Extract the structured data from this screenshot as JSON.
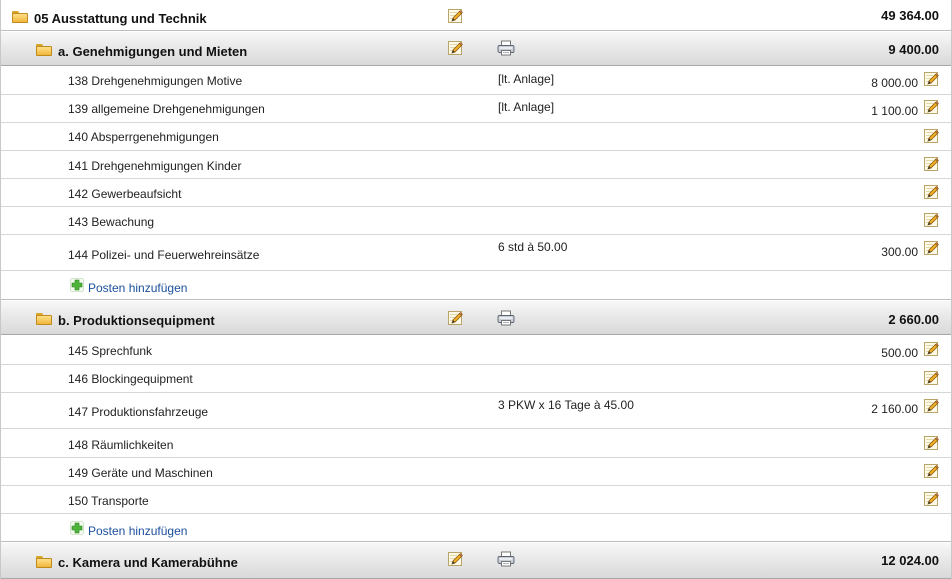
{
  "top": {
    "title": "05 Ausstattung und Technik",
    "total": "49 364.00"
  },
  "sections": [
    {
      "title": "a. Genehmigungen und Mieten",
      "total": "9 400.00",
      "items": [
        {
          "label": "138 Drehgenehmigungen Motive",
          "note": "[lt. Anlage]",
          "amount": "8 000.00"
        },
        {
          "label": "139 allgemeine Drehgenehmigungen",
          "note": "[lt. Anlage]",
          "amount": "1 100.00"
        },
        {
          "label": "140 Absperrgenehmigungen",
          "note": "",
          "amount": ""
        },
        {
          "label": "141 Drehgenehmigungen Kinder",
          "note": "",
          "amount": ""
        },
        {
          "label": "142 Gewerbeaufsicht",
          "note": "",
          "amount": ""
        },
        {
          "label": "143 Bewachung",
          "note": "",
          "amount": ""
        },
        {
          "label": "144 Polizei- und Feuerwehreinsätze",
          "note": "6 std  à 50.00",
          "amount": "300.00"
        }
      ],
      "add_label": "Posten hinzufügen"
    },
    {
      "title": "b. Produktionsequipment",
      "total": "2 660.00",
      "items": [
        {
          "label": "145 Sprechfunk",
          "note": "",
          "amount": "500.00"
        },
        {
          "label": "146 Blockingequipment",
          "note": "",
          "amount": ""
        },
        {
          "label": "147 Produktionsfahrzeuge",
          "note": "3 PKW x 16 Tage  à 45.00",
          "amount": "2 160.00"
        },
        {
          "label": "148 Räumlichkeiten",
          "note": "",
          "amount": ""
        },
        {
          "label": "149 Geräte und Maschinen",
          "note": "",
          "amount": ""
        },
        {
          "label": "150 Transporte",
          "note": "",
          "amount": ""
        }
      ],
      "add_label": "Posten hinzufügen"
    },
    {
      "title": "c. Kamera und Kamerabühne",
      "total": "12 024.00"
    }
  ]
}
